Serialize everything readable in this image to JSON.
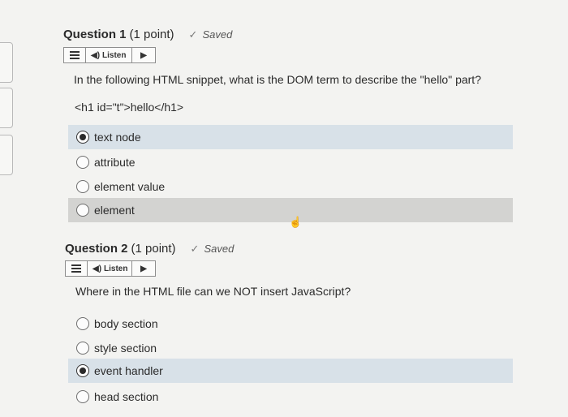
{
  "q1": {
    "title": "Question 1",
    "points": "(1 point)",
    "saved": "Saved",
    "listen": "Listen",
    "prompt": "In the following HTML snippet, what is the DOM term to describe the \"hello\" part?",
    "code": "<h1 id=\"t\">hello</h1>",
    "options": [
      "text node",
      "attribute",
      "element value",
      "element"
    ],
    "selected_index": 0
  },
  "q2": {
    "title": "Question 2",
    "points": "(1 point)",
    "saved": "Saved",
    "listen": "Listen",
    "prompt": "Where in the HTML file can we NOT insert JavaScript?",
    "options": [
      "body section",
      "style section",
      "event handler",
      "head section"
    ],
    "selected_index": 2
  },
  "icons": [
    "check-icon",
    "menu-icon",
    "speaker-icon",
    "play-icon",
    "radio-icon",
    "hand-cursor-icon"
  ]
}
